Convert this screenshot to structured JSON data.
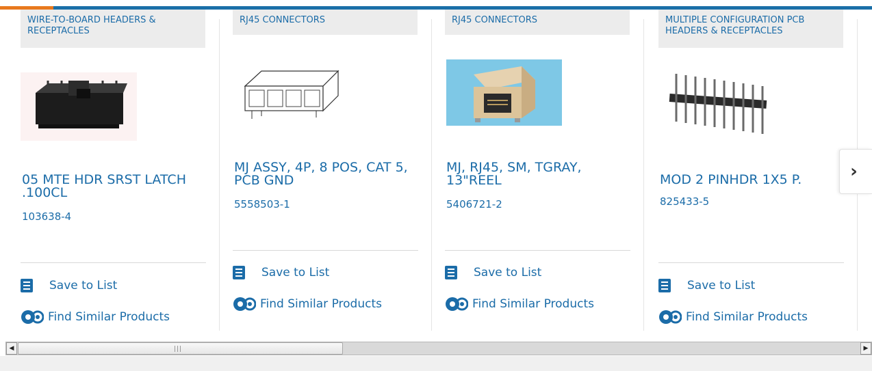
{
  "products": [
    {
      "category": "WIRE-TO-BOARD HEADERS & RECEPTACLES",
      "title": "05 MTE HDR SRST LATCH .100CL",
      "part_number": "103638-4",
      "save_label": "Save to List",
      "similar_label": "Find Similar Products",
      "image_icon": "wire-to-board-header-image"
    },
    {
      "category": "RJ45 CONNECTORS",
      "title": "MJ ASSY, 4P, 8 POS, CAT 5, PCB GND",
      "part_number": "5558503-1",
      "save_label": "Save to List",
      "similar_label": "Find Similar Products",
      "image_icon": "rj45-4-port-image"
    },
    {
      "category": "RJ45 CONNECTORS",
      "title": "MJ, RJ45, SM, TGRAY, 13\"REEL",
      "part_number": "5406721-2",
      "save_label": "Save to List",
      "similar_label": "Find Similar Products",
      "image_icon": "rj45-single-image"
    },
    {
      "category": "MULTIPLE CONFIGURATION PCB HEADERS & RECEPTACLES",
      "title": "MOD 2 PINHDR 1X5 P.",
      "part_number": "825433-5",
      "save_label": "Save to List",
      "similar_label": "Find Similar Products",
      "image_icon": "pin-header-image"
    }
  ],
  "navigation": {
    "next_icon": "chevron-right-icon"
  },
  "colors": {
    "brand_blue": "#1b6ca8",
    "accent_orange": "#e8791e"
  }
}
